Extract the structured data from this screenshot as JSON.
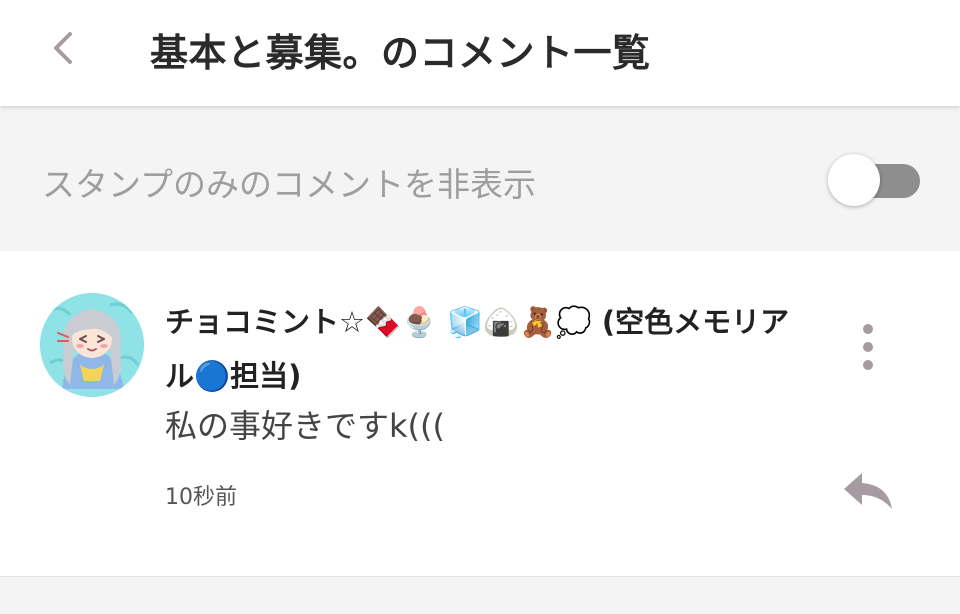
{
  "header": {
    "title": "基本と募集。のコメント一覧",
    "back_icon": "chevron-left-icon"
  },
  "filter": {
    "label": "スタンプのみのコメントを非表示",
    "toggle_on": false
  },
  "comments": [
    {
      "user_name": "チョコミント☆🍫🍨 🧊🍙🧸💭 (空色メモリアル🔵担当)",
      "text": "私の事好きですk(((",
      "timestamp": "10秒前",
      "avatar_icon": "anime-avatar",
      "more_icon": "more-vertical-icon",
      "reply_icon": "reply-icon"
    }
  ],
  "colors": {
    "header_bg": "#ffffff",
    "page_bg": "#f4f4f4",
    "title_text": "#2a2a2a",
    "muted_text": "#9e9e9e",
    "icon_gray": "#a59ba0",
    "toggle_track": "#8e8e8e",
    "avatar_bg": "#8fe2e6"
  }
}
